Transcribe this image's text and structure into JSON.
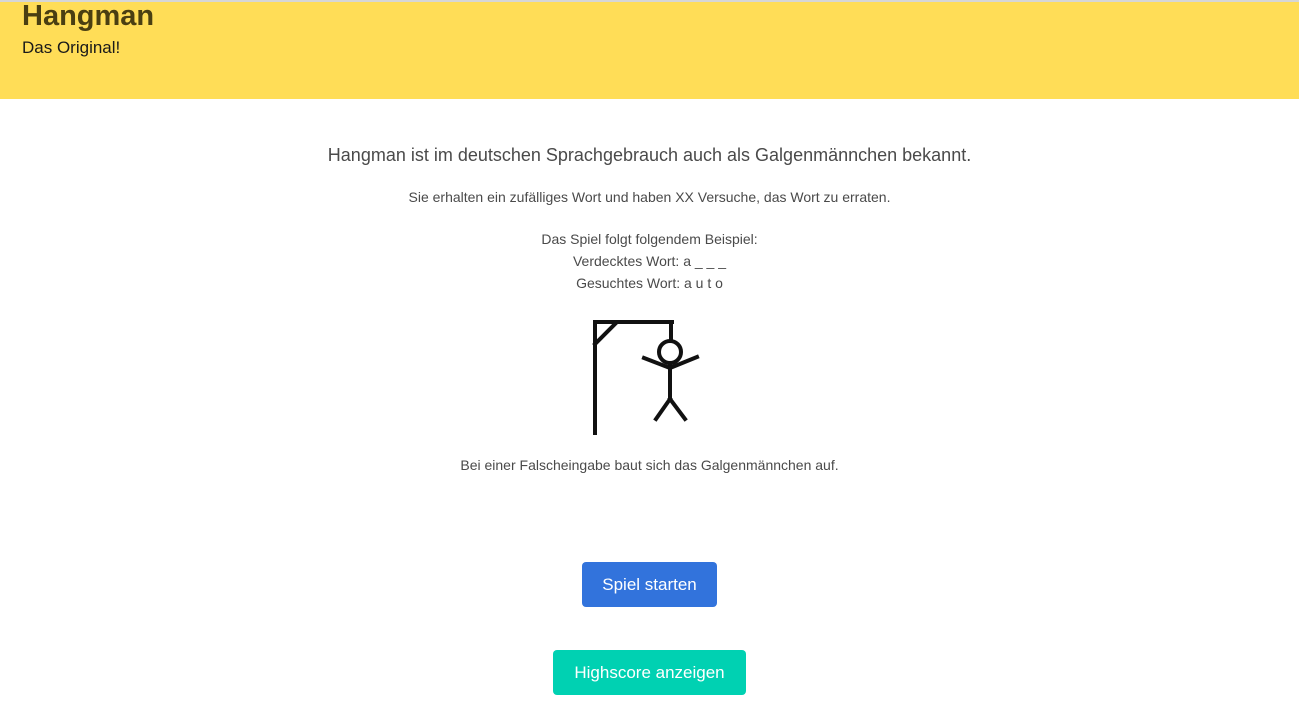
{
  "header": {
    "title": "Hangman",
    "subtitle": "Das Original!"
  },
  "intro": {
    "lead": "Hangman ist im deutschen Sprachgebrauch auch als Galgenmännchen bekannt.",
    "text": "Sie erhalten ein zufälliges Wort und haben XX Versuche, das Wort zu erraten."
  },
  "example": {
    "heading": "Das Spiel folgt folgendem Beispiel:",
    "hidden_word": "Verdecktes Wort: a _ _ _",
    "searched_word": "Gesuchtes Wort: a u t o"
  },
  "illustration": {
    "icon": "hangman-gallows-icon"
  },
  "note": "Bei einer Falscheingabe baut sich das Galgenmännchen auf.",
  "buttons": {
    "start_label": "Spiel starten",
    "highscore_label": "Highscore anzeigen"
  },
  "colors": {
    "header_bg": "#ffdd57",
    "start_button": "#3273dc",
    "highscore_button": "#00d1b2"
  }
}
